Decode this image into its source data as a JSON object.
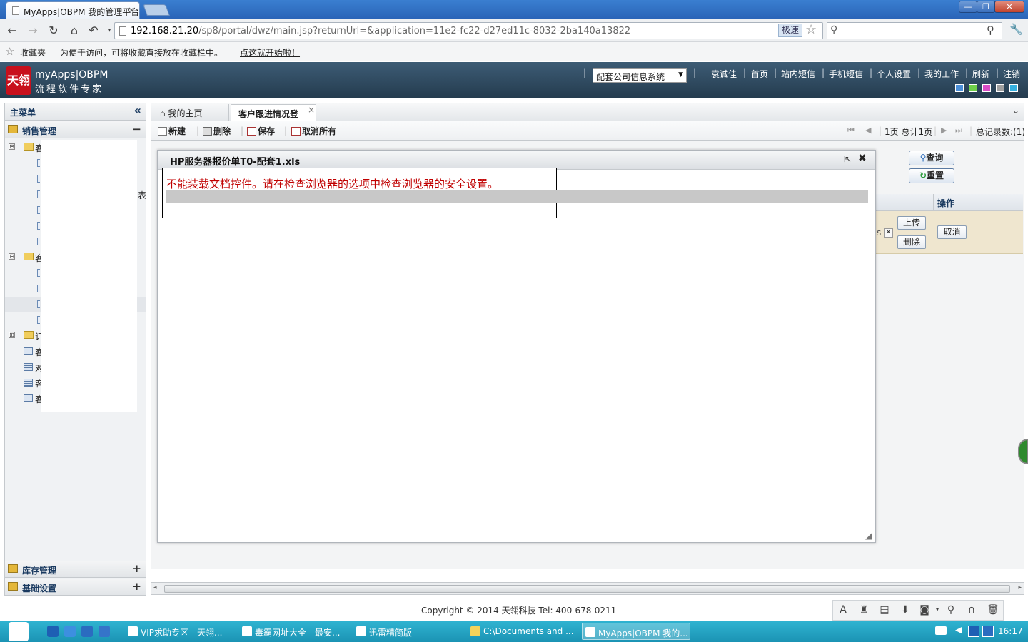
{
  "browser": {
    "tab_title": "MyApps|OBPM 我的管理平台",
    "tab_close": "×",
    "address_host": "192.168.21.20",
    "address_rest": "/sp8/portal/dwz/main.jsp?returnUrl=&application=11e2-fc22-d27ed11c-8032-2ba140a13822",
    "speed_label": "极速",
    "window_min": "—",
    "window_max": "❐",
    "window_close": "✕"
  },
  "bookmarks": {
    "fav_label": "收藏夹",
    "hint_text": "为便于访问，可将收藏直接放在收藏栏中。",
    "hint_link": "点这就开始啦！"
  },
  "header": {
    "logo_mark": "天翎",
    "logo_title": "myApps|OBPM",
    "logo_subtitle": "流程软件专家",
    "system_select": "配套公司信息系统",
    "links": [
      "袁诚佳",
      "首页",
      "站内短信",
      "手机短信",
      "个人设置",
      "我的工作",
      "刷新",
      "注销"
    ],
    "swatches": [
      "#4b8fd8",
      "#6fcf4a",
      "#d94cc6",
      "#a0a0a0",
      "#35b0e0"
    ]
  },
  "sidebar": {
    "title": "主菜单",
    "collapse": "«",
    "sections": [
      {
        "label": "销售管理",
        "toggle": "−"
      },
      {
        "label": "库存管理",
        "toggle": "+"
      },
      {
        "label": "基础设置",
        "toggle": "+"
      }
    ],
    "tree_labels": [
      "客",
      "客",
      "订",
      "客",
      "对",
      "客",
      "客"
    ],
    "tree_fold": [
      "⊟",
      "⊟",
      "⊞"
    ],
    "side_text": "表"
  },
  "content": {
    "tabs": [
      {
        "label": "我的主页"
      },
      {
        "label": "客户跟进情况登",
        "close": "×"
      }
    ],
    "toolbar": {
      "new": "新建",
      "delete": "删除",
      "save": "保存",
      "cancel_all": "取消所有"
    },
    "pager": {
      "page_info": "1页 总计1页",
      "total": "总记录数:(1)"
    },
    "query_button": "查询",
    "reset_button": "重置",
    "op_header": "操作",
    "row": {
      "upload": "上传",
      "remove": "删除",
      "cancel": "取消",
      "file_tail": "s",
      "file_x": "✕"
    }
  },
  "dialog": {
    "title": "HP服务器报价单T0-配套1.xls",
    "error": "不能装载文档控件。请在检查浏览器的选项中检查浏览器的安全设置。"
  },
  "footer": {
    "copyright": "Copyright © 2014 天翎科技 Tel: 400-678-0211"
  },
  "taskbar": {
    "tasks": [
      {
        "label": "VIP求助专区 - 天翎..."
      },
      {
        "label": "毒霸网址大全 - 最安..."
      },
      {
        "label": "迅雷精简版"
      },
      {
        "label": "C:\\Documents and ..."
      },
      {
        "label": "MyApps|OBPM 我的..."
      }
    ],
    "time": "16:17"
  }
}
